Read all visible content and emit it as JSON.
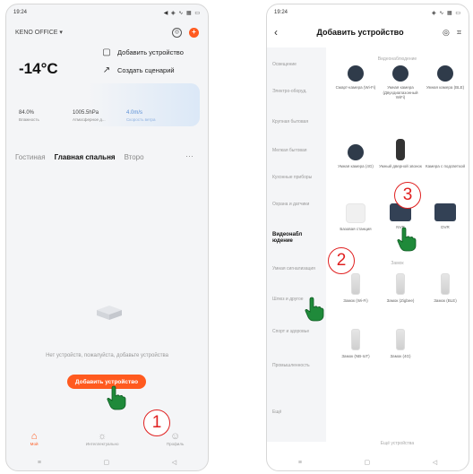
{
  "phone1": {
    "status": {
      "time": "19:24",
      "icons": "◀ ◈ ∿ ▦ ▭"
    },
    "home_name": "KENO OFFICE",
    "menu": {
      "add_device": "Добавить устройство",
      "create_scenario": "Создать сценарий"
    },
    "temperature": "-14°C",
    "weather": [
      {
        "value": "84.0%",
        "label": "Влажность"
      },
      {
        "value": "1005.5hPa",
        "label": "Атмосферное д..."
      },
      {
        "value": "4.0m/s",
        "label": "Скорость ветра"
      }
    ],
    "rooms": [
      "Гостиная",
      "Главная спальня",
      "Второ"
    ],
    "rooms_more": "···",
    "empty_text": "Нет устройств, пожалуйста, добавьте устройства",
    "add_button": "Добавить устройство",
    "tabs": [
      "Мой",
      "Интеллектуально",
      "Профиль"
    ]
  },
  "phone2": {
    "status": {
      "time": "19:24",
      "icons": "◈ ∿ ▦ ▭"
    },
    "title": "Добавить устройство",
    "categories": [
      "Освещение",
      "Электро-оборуд.",
      "Крупная бытовая",
      "Мелкая бытовая",
      "Кухонные приборы",
      "Охрана и датчики",
      "Видеонаблюдение",
      "Умная сигнализация",
      "Шлюз и другое",
      "Спорт и здоровье",
      "Промышленность",
      "Ещё"
    ],
    "selected_category": "Видеонабл юдение",
    "section_top": "Видеонаблюдение",
    "devices": [
      "Смарт-камера (Wi-Fi)",
      "Умная камера (Двухдиапазонный WiFi)",
      "Умная камера (BLE)",
      "Умная камера (4G)",
      "Умный дверной звонок",
      "Камера с подсветкой",
      "Базовая станция",
      "NVR",
      "DVR"
    ],
    "section_locks": "Замок",
    "locks": [
      "Замок (Wi-Fi)",
      "Замок (Zigbee)",
      "Замок (BLE)",
      "Замок (NB-IoT)",
      "Замок (4G)"
    ],
    "more_link": "Ещё устройства"
  },
  "annotations": [
    "1",
    "2",
    "3"
  ],
  "colors": {
    "accent": "#ff5a1f",
    "annotation": "#e02020",
    "hand": "#1f8a3a"
  }
}
